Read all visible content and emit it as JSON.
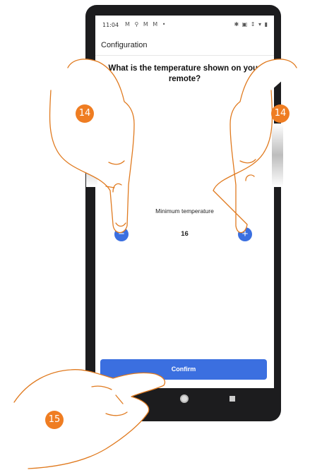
{
  "status_bar": {
    "time": "11:04",
    "left_icons": "M ⚲ M M •",
    "right_icons": "✱ ▣ ↕ ▾ ▮"
  },
  "app_bar": {
    "title": "Configuration"
  },
  "main": {
    "question": "What is the temperature shown on your remote?",
    "min_temp_label": "Minimum temperature",
    "min_temp_value": "16",
    "decrement_symbol": "−",
    "increment_symbol": "+",
    "confirm_label": "Confirm"
  },
  "overlay": {
    "window_icons": "⧉ ✕",
    "step_left": "14",
    "step_right": "14",
    "step_bottom": "15"
  },
  "colors": {
    "accent": "#3b6fe0",
    "badge": "#ef7d22",
    "hand_outline": "#e07a1f"
  }
}
